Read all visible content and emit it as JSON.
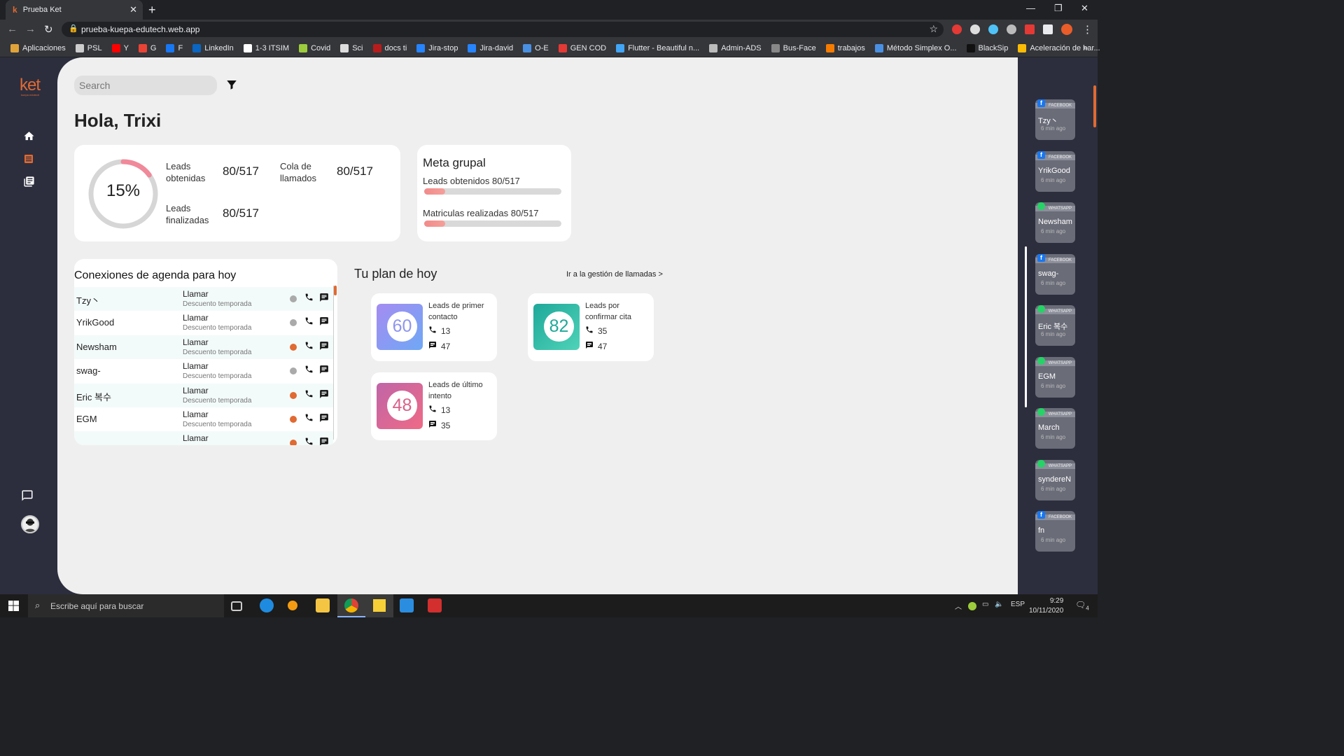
{
  "browser": {
    "tab_title": "Prueba Ket",
    "url": "prueba-kuepa-edutech.web.app",
    "bookmarks": [
      "Aplicaciones",
      "PSL",
      "Y",
      "G",
      "F",
      "LinkedIn",
      "1-3 ITSIM",
      "Covid",
      "Sci",
      "docs ti",
      "Jira-stop",
      "Jira-david",
      "O-E",
      "GEN COD",
      "Flutter - Beautiful n...",
      "Admin-ADS",
      "Bus-Face",
      "trabajos",
      "Método Simplex O...",
      "BlackSip",
      "Aceleración de har..."
    ],
    "bookmarks_more": "»"
  },
  "app": {
    "logo": "ket",
    "logo_sub": "kuepa edutech",
    "search_placeholder": "Search",
    "greeting": "Hola, Trixi"
  },
  "stats": {
    "percent": "15%",
    "percent_value": 0.15,
    "leads_obtenidas_label": "Leads obtenidas",
    "leads_obtenidas_value": "80/517",
    "cola_label": "Cola de llamados",
    "cola_value": "80/517",
    "leads_finalizadas_label": "Leads finalizadas",
    "leads_finalizadas_value": "80/517"
  },
  "meta_grupal": {
    "title": "Meta grupal",
    "leads_label": "Leads obtenidos 80/517",
    "leads_progress": 0.155,
    "matriculas_label": "Matriculas realizadas 80/517",
    "matriculas_progress": 0.155
  },
  "agenda": {
    "title": "Conexiones de agenda para hoy",
    "rows": [
      {
        "name": "Tzy丶",
        "action": "Llamar",
        "sub": "Descuento temporada",
        "status": "#aaaaaa"
      },
      {
        "name": "YrikGood",
        "action": "Llamar",
        "sub": "Descuento temporada",
        "status": "#aaaaaa"
      },
      {
        "name": "Newsham",
        "action": "Llamar",
        "sub": "Descuento temporada",
        "status": "#e06a32"
      },
      {
        "name": "swag-",
        "action": "Llamar",
        "sub": "Descuento temporada",
        "status": "#aaaaaa"
      },
      {
        "name": "Eric 복수",
        "action": "Llamar",
        "sub": "Descuento temporada",
        "status": "#e06a32"
      },
      {
        "name": "EGM",
        "action": "Llamar",
        "sub": "Descuento temporada",
        "status": "#e06a32"
      },
      {
        "name": "",
        "action": "Llamar",
        "sub": "",
        "status": "#e06a32"
      }
    ]
  },
  "plan": {
    "title": "Tu plan de hoy",
    "link": "Ir a la gestión de llamadas >",
    "tiles": [
      {
        "number": "60",
        "title": "Leads de primer contacto",
        "calls": "13",
        "messages": "47"
      },
      {
        "number": "82",
        "title": "Leads por confirmar cita",
        "calls": "35",
        "messages": "47"
      },
      {
        "number": "48",
        "title": "Leads de último intento",
        "calls": "13",
        "messages": "35"
      }
    ]
  },
  "notifications": [
    {
      "source": "FACEBOOK",
      "name": "Tzy丶",
      "time": "6 min ago"
    },
    {
      "source": "FACEBOOK",
      "name": "YrikGood",
      "time": "6 min ago"
    },
    {
      "source": "WHATSAPP",
      "name": "Newsham",
      "time": "6 min ago"
    },
    {
      "source": "FACEBOOK",
      "name": "swag-",
      "time": "6 min ago"
    },
    {
      "source": "WHATSAPP",
      "name": "Eric 복수",
      "time": "6 min ago"
    },
    {
      "source": "WHATSAPP",
      "name": "EGM",
      "time": "6 min ago"
    },
    {
      "source": "WHATSAPP",
      "name": "March",
      "time": "6 min ago"
    },
    {
      "source": "WHATSAPP",
      "name": "syndereN",
      "time": "6 min ago"
    },
    {
      "source": "FACEBOOK",
      "name": "fn",
      "time": "6 min ago"
    }
  ],
  "taskbar": {
    "search_placeholder": "Escribe aquí para buscar",
    "lang": "ESP",
    "time": "9:29",
    "date": "10/11/2020",
    "notif_count": "4"
  },
  "colors": {
    "accent": "#e06a32",
    "nav_bg": "#2c2e3e",
    "main_bg": "#efefef",
    "tile1": "#8fa3f7",
    "tile2": "#1fa89a",
    "tile3": "#d9608a",
    "facebook": "#1877f2",
    "whatsapp": "#25d366"
  }
}
